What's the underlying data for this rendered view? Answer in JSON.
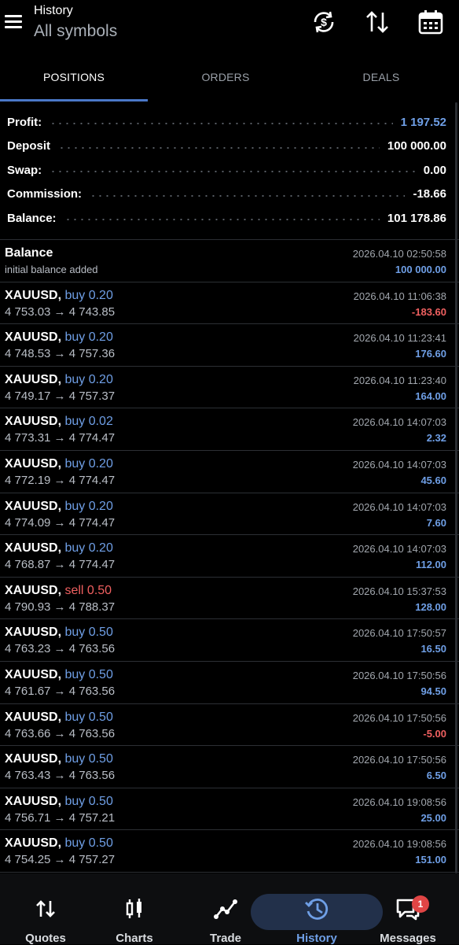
{
  "header": {
    "title": "History",
    "subtitle": "All symbols",
    "icons": [
      "menu-icon",
      "currency-sync-icon",
      "sort-icon",
      "calendar-icon"
    ]
  },
  "tabs": [
    {
      "label": "POSITIONS",
      "active": true
    },
    {
      "label": "ORDERS",
      "active": false
    },
    {
      "label": "DEALS",
      "active": false
    }
  ],
  "summary": {
    "profit": {
      "label": "Profit:",
      "value": "1 197.52"
    },
    "deposit": {
      "label": "Deposit",
      "value": "100 000.00"
    },
    "swap": {
      "label": "Swap:",
      "value": "0.00"
    },
    "commission": {
      "label": "Commission:",
      "value": "-18.66"
    },
    "balance": {
      "label": "Balance:",
      "value": "101 178.86"
    }
  },
  "balance_entry": {
    "title": "Balance",
    "note": "initial balance added",
    "date": "2026.04.10 02:50:58",
    "amount": "100 000.00"
  },
  "deals": [
    {
      "symbol": "XAUUSD,",
      "dir": "buy",
      "volume": "buy 0.20",
      "prices": "4 753.03 → 4 743.85",
      "date": "2026.04.10 11:06:38",
      "pnl": "-183.60",
      "negative": true
    },
    {
      "symbol": "XAUUSD,",
      "dir": "buy",
      "volume": "buy 0.20",
      "prices": "4 748.53 → 4 757.36",
      "date": "2026.04.10 11:23:41",
      "pnl": "176.60",
      "negative": false
    },
    {
      "symbol": "XAUUSD,",
      "dir": "buy",
      "volume": "buy 0.20",
      "prices": "4 749.17 → 4 757.37",
      "date": "2026.04.10 11:23:40",
      "pnl": "164.00",
      "negative": false
    },
    {
      "symbol": "XAUUSD,",
      "dir": "buy",
      "volume": "buy 0.02",
      "prices": "4 773.31 → 4 774.47",
      "date": "2026.04.10 14:07:03",
      "pnl": "2.32",
      "negative": false
    },
    {
      "symbol": "XAUUSD,",
      "dir": "buy",
      "volume": "buy 0.20",
      "prices": "4 772.19 → 4 774.47",
      "date": "2026.04.10 14:07:03",
      "pnl": "45.60",
      "negative": false
    },
    {
      "symbol": "XAUUSD,",
      "dir": "buy",
      "volume": "buy 0.20",
      "prices": "4 774.09 → 4 774.47",
      "date": "2026.04.10 14:07:03",
      "pnl": "7.60",
      "negative": false
    },
    {
      "symbol": "XAUUSD,",
      "dir": "buy",
      "volume": "buy 0.20",
      "prices": "4 768.87 → 4 774.47",
      "date": "2026.04.10 14:07:03",
      "pnl": "112.00",
      "negative": false
    },
    {
      "symbol": "XAUUSD,",
      "dir": "sell",
      "volume": "sell 0.50",
      "prices": "4 790.93 → 4 788.37",
      "date": "2026.04.10 15:37:53",
      "pnl": "128.00",
      "negative": false
    },
    {
      "symbol": "XAUUSD,",
      "dir": "buy",
      "volume": "buy 0.50",
      "prices": "4 763.23 → 4 763.56",
      "date": "2026.04.10 17:50:57",
      "pnl": "16.50",
      "negative": false
    },
    {
      "symbol": "XAUUSD,",
      "dir": "buy",
      "volume": "buy 0.50",
      "prices": "4 761.67 → 4 763.56",
      "date": "2026.04.10 17:50:56",
      "pnl": "94.50",
      "negative": false
    },
    {
      "symbol": "XAUUSD,",
      "dir": "buy",
      "volume": "buy 0.50",
      "prices": "4 763.66 → 4 763.56",
      "date": "2026.04.10 17:50:56",
      "pnl": "-5.00",
      "negative": true
    },
    {
      "symbol": "XAUUSD,",
      "dir": "buy",
      "volume": "buy 0.50",
      "prices": "4 763.43 → 4 763.56",
      "date": "2026.04.10 17:50:56",
      "pnl": "6.50",
      "negative": false
    },
    {
      "symbol": "XAUUSD,",
      "dir": "buy",
      "volume": "buy 0.50",
      "prices": "4 756.71 → 4 757.21",
      "date": "2026.04.10 19:08:56",
      "pnl": "25.00",
      "negative": false
    },
    {
      "symbol": "XAUUSD,",
      "dir": "buy",
      "volume": "buy 0.50",
      "prices": "4 754.25 → 4 757.27",
      "date": "2026.04.10 19:08:56",
      "pnl": "151.00",
      "negative": false
    }
  ],
  "nav": [
    {
      "label": "Quotes",
      "icon": "quotes-arrows-icon",
      "active": false
    },
    {
      "label": "Charts",
      "icon": "candlestick-icon",
      "active": false
    },
    {
      "label": "Trade",
      "icon": "trend-line-icon",
      "active": false
    },
    {
      "label": "History",
      "icon": "history-clock-icon",
      "active": true
    },
    {
      "label": "Messages",
      "icon": "chat-bubbles-icon",
      "active": false,
      "badge": "1"
    }
  ],
  "colors": {
    "accent": "#4a78c8",
    "positive": "#6f9fe6",
    "negative": "#f06060",
    "background": "#000000"
  }
}
